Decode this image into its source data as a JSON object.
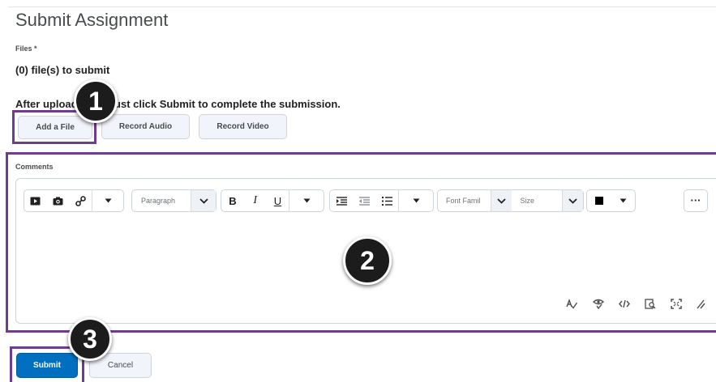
{
  "page": {
    "title": "Submit Assignment",
    "files_label": "Files *",
    "files_count": "(0) file(s) to submit",
    "instruction": "After upload, you must click Submit to complete the submission."
  },
  "file_buttons": {
    "add_file": "Add a File",
    "record_audio": "Record Audio",
    "record_video": "Record Video"
  },
  "comments": {
    "label": "Comments",
    "toolbar": {
      "paragraph": "Paragraph",
      "bold": "B",
      "italic": "I",
      "underline": "U",
      "font_family": "Font Famil",
      "size": "Size",
      "more": "···"
    },
    "bottom_icons": [
      "spellcheck-icon",
      "accessibility-icon",
      "source-code-icon",
      "preview-icon",
      "fullscreen-icon",
      "resize-icon"
    ]
  },
  "actions": {
    "submit": "Submit",
    "cancel": "Cancel"
  },
  "callouts": [
    "1",
    "2",
    "3"
  ],
  "colors": {
    "highlight": "#6d3d8f",
    "primary": "#006fbf",
    "badge": "#1c1c1c"
  }
}
